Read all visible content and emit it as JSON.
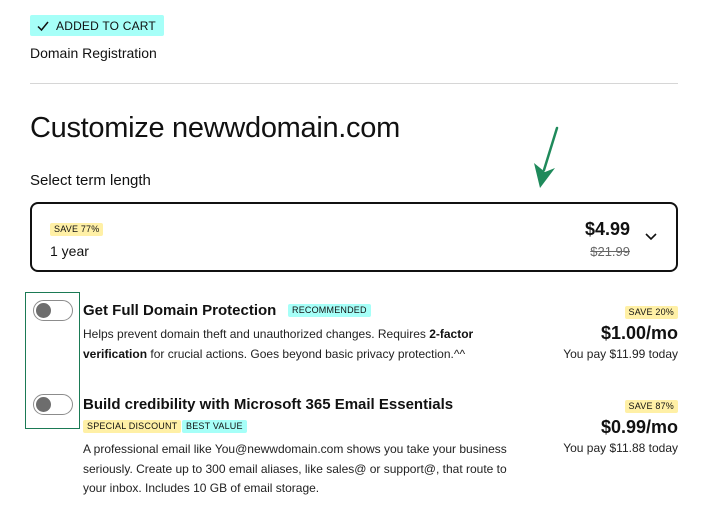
{
  "cart": {
    "badge": "ADDED TO CART",
    "product": "Domain Registration"
  },
  "page": {
    "title": "Customize newwdomain.com"
  },
  "term": {
    "label": "Select term length",
    "save_tag": "SAVE 77%",
    "selected": "1 year",
    "price": "$4.99",
    "original_price": "$21.99"
  },
  "addons": [
    {
      "title": "Get Full Domain Protection",
      "tags": [
        "RECOMMENDED"
      ],
      "desc_part1": "Helps prevent domain theft and unauthorized changes. Requires ",
      "desc_bold": "2-factor verification",
      "desc_part2": " for crucial actions. Goes beyond basic privacy protection.^^",
      "save_tag": "SAVE 20%",
      "price": "$1.00/mo",
      "you_pay": "You pay $11.99 today",
      "enabled": false
    },
    {
      "title": "Build credibility with Microsoft 365 Email Essentials",
      "tags": [
        "SPECIAL DISCOUNT",
        "BEST VALUE"
      ],
      "desc": "A professional email like You@newwdomain.com shows you take your business seriously. Create up to 300 email aliases, like sales@ or support@, that route to your inbox. Includes 10 GB of email storage.",
      "save_tag": "SAVE 87%",
      "price": "$0.99/mo",
      "you_pay": "You pay $11.88 today",
      "enabled": false
    }
  ],
  "colors": {
    "cyan_tag": "#a6fff8",
    "yellow_tag": "#fff0a6",
    "highlight_green": "#1b7a55",
    "arrow_green": "#1f8a5b"
  },
  "icons": {
    "badge": "check-icon",
    "select": "chevron-down-icon",
    "annotation": "arrow-icon"
  }
}
